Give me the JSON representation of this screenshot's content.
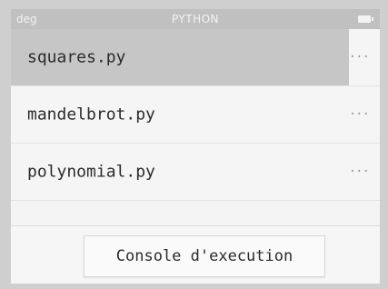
{
  "statusbar": {
    "angle_mode": "deg",
    "app_title": "PYTHON",
    "battery_icon": "battery-icon"
  },
  "files": [
    {
      "name": "squares.py",
      "more_icon": "···",
      "selected": true
    },
    {
      "name": "mandelbrot.py",
      "more_icon": "···",
      "selected": false
    },
    {
      "name": "polynomial.py",
      "more_icon": "···",
      "selected": false
    }
  ],
  "console_button": {
    "label": "Console d'execution"
  },
  "colors": {
    "statusbar_bg": "#c0c0c0",
    "selected_row_bg": "#c6c6c6",
    "row_bg": "#f5f5f5"
  }
}
